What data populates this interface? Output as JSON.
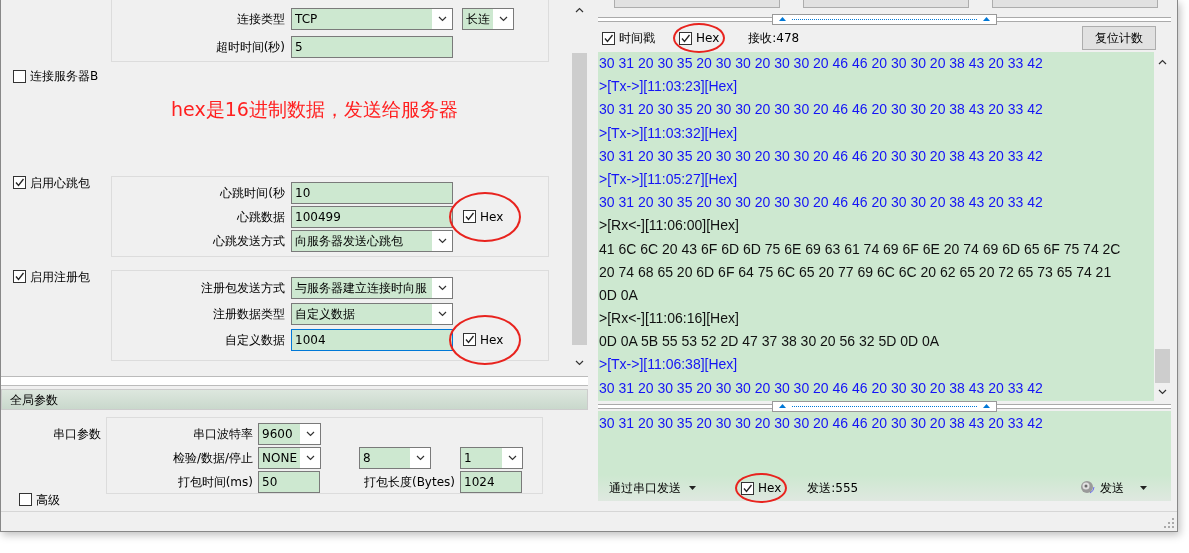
{
  "left_panel": {
    "server_a_group": {
      "fields": [
        {
          "label": "连接类型",
          "kind": "select",
          "value": "TCP",
          "side_value": "长连"
        },
        {
          "label": "超时时间(秒)",
          "kind": "input",
          "value": "5"
        }
      ]
    },
    "server_b": {
      "label": "连接服务器B",
      "checked": false
    },
    "annotation": "hex是16进制数据，发送给服务器",
    "heartbeat": {
      "label": "启用心跳包",
      "checked": true,
      "fields": [
        {
          "label": "心跳时间(秒",
          "kind": "input",
          "value": "10"
        },
        {
          "label": "心跳数据",
          "kind": "input",
          "value": "100499",
          "hex": {
            "label": "Hex",
            "checked": true,
            "circled": true
          }
        },
        {
          "label": "心跳发送方式",
          "kind": "select",
          "value": "向服务器发送心跳包"
        }
      ]
    },
    "register": {
      "label": "启用注册包",
      "checked": true,
      "fields": [
        {
          "label": "注册包发送方式",
          "kind": "select",
          "value": "与服务器建立连接时向服"
        },
        {
          "label": "注册数据类型",
          "kind": "select",
          "value": "自定义数据"
        },
        {
          "label": "自定义数据",
          "kind": "input",
          "value": "1004",
          "focused": true,
          "hex": {
            "label": "Hex",
            "checked": true,
            "circled": true
          }
        }
      ]
    }
  },
  "global_params": {
    "title": "全局参数",
    "serial_label": "串口参数",
    "rows": [
      {
        "cells": [
          {
            "kind": "label",
            "text": "串口波特率"
          },
          {
            "kind": "select",
            "value": "9600"
          }
        ]
      },
      {
        "cells": [
          {
            "kind": "label",
            "text": "检验/数据/停止"
          },
          {
            "kind": "select",
            "value": "NONE"
          },
          {
            "kind": "select",
            "value": "8"
          },
          {
            "kind": "select",
            "value": "1"
          }
        ]
      },
      {
        "cells": [
          {
            "kind": "label",
            "text": "打包时间(ms)"
          },
          {
            "kind": "input",
            "value": "50"
          },
          {
            "kind": "label",
            "text": "打包长度(Bytes)"
          },
          {
            "kind": "input",
            "value": "1024"
          }
        ]
      }
    ],
    "advanced": {
      "label": "高级",
      "checked": false
    }
  },
  "receive": {
    "timestamp": {
      "label": "时间戳",
      "checked": true
    },
    "hex": {
      "label": "Hex",
      "checked": true,
      "circled": true
    },
    "count": "接收:478",
    "reset_button": "复位计数",
    "log": [
      {
        "kind": "tx",
        "text": "30 31 20 30 35 20 30 30 20 30 30 20 46 46 20 30 30 20 38 43 20 33 42"
      },
      {
        "kind": "tx",
        "text": ">[Tx->][11:03:23][Hex]"
      },
      {
        "kind": "tx",
        "text": "30 31 20 30 35 20 30 30 20 30 30 20 46 46 20 30 30 20 38 43 20 33 42"
      },
      {
        "kind": "tx",
        "text": ">[Tx->][11:03:32][Hex]"
      },
      {
        "kind": "tx",
        "text": "30 31 20 30 35 20 30 30 20 30 30 20 46 46 20 30 30 20 38 43 20 33 42"
      },
      {
        "kind": "tx",
        "text": ">[Tx->][11:05:27][Hex]"
      },
      {
        "kind": "tx",
        "text": "30 31 20 30 35 20 30 30 20 30 30 20 46 46 20 30 30 20 38 43 20 33 42"
      },
      {
        "kind": "rx",
        "text": ">[Rx<-][11:06:00][Hex]"
      },
      {
        "kind": "rx",
        "text": "41 6C 6C 20 43 6F 6D 6D 75 6E 69 63 61 74 69 6F 6E 20 74 69 6D 65 6F 75 74 2C"
      },
      {
        "kind": "rx",
        "text": "20 74 68 65 20 6D 6F 64 75 6C 65 20 77 69 6C 6C 20 62 65 20 72 65 73 65 74 21"
      },
      {
        "kind": "rx",
        "text": "0D 0A"
      },
      {
        "kind": "rx",
        "text": ">[Rx<-][11:06:16][Hex]"
      },
      {
        "kind": "rx",
        "text": "0D 0A 5B 55 53 52 2D 47 37 38 30 20 56 32 5D 0D 0A"
      },
      {
        "kind": "tx",
        "text": ">[Tx->][11:06:38][Hex]"
      },
      {
        "kind": "tx",
        "text": "30 31 20 30 35 20 30 30 20 30 30 20 46 46 20 30 30 20 38 43 20 33 42"
      }
    ]
  },
  "send": {
    "text": "30 31 20 30 35 20 30 30 20 30 30 20 46 46 20 30 30 20 38 43 20 33 42",
    "mode": "通过串口发送",
    "hex": {
      "label": "Hex",
      "checked": true,
      "circled": true
    },
    "count": "发送:555",
    "send_button": "发送"
  }
}
